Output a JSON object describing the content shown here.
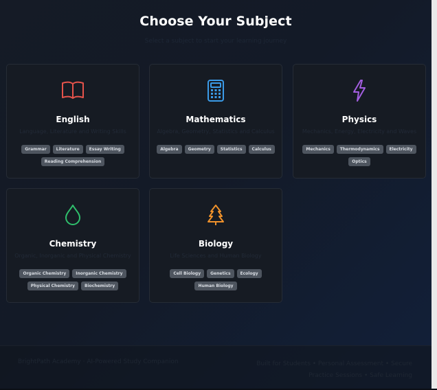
{
  "page": {
    "title": "Choose Your Subject",
    "subtitle": "Select a subject to start your learning journey"
  },
  "subjects": [
    {
      "name": "English",
      "icon": "book-icon",
      "color": "#e5534b",
      "description": "Language, Literature and Writing Skills",
      "tags": [
        "Grammar",
        "Literature",
        "Essay Writing",
        "Reading Comprehension"
      ]
    },
    {
      "name": "Mathematics",
      "icon": "calculator-icon",
      "color": "#3b9be8",
      "description": "Algebra, Geometry, Statistics and Calculus",
      "tags": [
        "Algebra",
        "Geometry",
        "Statistics",
        "Calculus"
      ]
    },
    {
      "name": "Physics",
      "icon": "lightning-icon",
      "color": "#a35ee0",
      "description": "Mechanics, Energy, Electricity and Waves",
      "tags": [
        "Mechanics",
        "Thermodynamics",
        "Electricity",
        "Optics"
      ]
    },
    {
      "name": "Chemistry",
      "icon": "droplet-icon",
      "color": "#2fbf6c",
      "description": "Organic, Inorganic and Physical Chemistry",
      "tags": [
        "Organic Chemistry",
        "Inorganic Chemistry",
        "Physical Chemistry",
        "Biochemistry"
      ]
    },
    {
      "name": "Biology",
      "icon": "tree-icon",
      "color": "#f0922b",
      "description": "Life Sciences and Human Biology",
      "tags": [
        "Cell Biology",
        "Genetics",
        "Ecology",
        "Human Biology"
      ]
    }
  ],
  "footer": {
    "left": "BrightPath Academy · AI-Powered Study Companion",
    "right_line1": "Built for Students • Personal Assessment • Secure",
    "right_line2": "Practice Sessions • Safe Learning"
  }
}
